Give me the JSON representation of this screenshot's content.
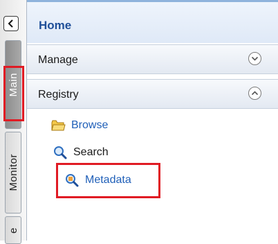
{
  "nav": {
    "home_title": "Home",
    "sections": {
      "manage": {
        "label": "Manage",
        "expanded": false
      },
      "registry": {
        "label": "Registry",
        "expanded": true
      }
    },
    "items": {
      "browse": {
        "label": "Browse",
        "icon": "folder-icon"
      },
      "search": {
        "label": "Search",
        "icon": "magnifier-icon"
      },
      "metadata": {
        "label": "Metadata",
        "icon": "metadata-search-icon"
      }
    }
  },
  "tabs": {
    "main": "Main",
    "monitor": "Monitor",
    "more": "e"
  },
  "colors": {
    "highlight": "#e01b24",
    "link": "#1f5fb8",
    "header_text": "#1f4f99"
  }
}
